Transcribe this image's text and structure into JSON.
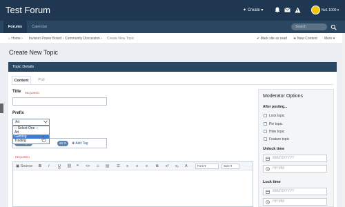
{
  "header": {
    "site_title": "Test Forum",
    "create_label": "Create",
    "user_name": "Nv1 1000"
  },
  "nav": {
    "forums": "Forums",
    "calendar": "Calendar",
    "search_placeholder": "Search"
  },
  "breadcrumbs": {
    "items": [
      "Home",
      "Invision Power Board",
      "Community Discussion",
      "Create New Topic"
    ],
    "mark_read": "Mark site as read",
    "new_content": "New Content",
    "more": "More"
  },
  "page": {
    "title": "Create New Topic",
    "section_header": "Topic Details",
    "tabs": [
      "Content",
      "Poll"
    ]
  },
  "form": {
    "title_label": "Title",
    "required_text": "REQUIRED",
    "prefix_label": "Prefix",
    "prefix_selected": "Art",
    "prefix_options": [
      "-- Select One --",
      "Art",
      "Gaming",
      "Trading"
    ],
    "prefix_highlighted_index": 2,
    "tags": [
      "Trading",
      "art"
    ],
    "add_tag": "Add Tag",
    "editor_required": "REQUIRED"
  },
  "toolbar": {
    "source": "Source",
    "bold": "B",
    "italic": "I",
    "underline": "U",
    "strike": "S",
    "font_label": "Font",
    "size_label": "Size"
  },
  "moderator": {
    "title": "Moderator Options",
    "after_posting": "After posting...",
    "options": [
      "Lock topic",
      "Pin topic",
      "Hide topic",
      "Feature topic"
    ],
    "unlock_label": "Unlock time",
    "lock_label": "Lock time",
    "date_placeholder": "MM/DD/YYYY",
    "time_placeholder": "HH:MM"
  },
  "colors": {
    "header_bg": "#1f3750",
    "nav_bg": "#2a4762",
    "required_red": "#d0322d",
    "highlight": "#3e7bd4"
  }
}
